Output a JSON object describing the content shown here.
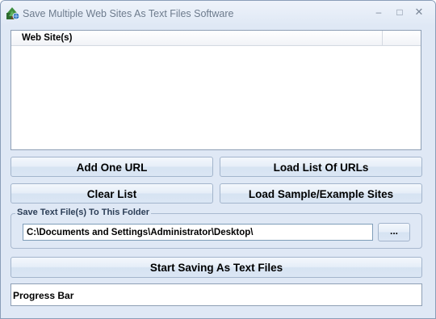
{
  "window": {
    "title": "Save Multiple Web Sites As Text Files Software",
    "minimize_glyph": "–",
    "maximize_glyph": "□",
    "close_glyph": "✕"
  },
  "list": {
    "column_header": "Web Site(s)",
    "items": []
  },
  "buttons": {
    "add_one_url": "Add One URL",
    "load_list": "Load List Of URLs",
    "clear_list": "Clear List",
    "load_sample": "Load Sample/Example Sites",
    "start": "Start Saving As Text Files"
  },
  "output_folder": {
    "group_label": "Save Text File(s) To This Folder",
    "path": "C:\\Documents and Settings\\Administrator\\Desktop\\",
    "browse_label": "..."
  },
  "progress": {
    "label": "Progress Bar",
    "value": 0
  },
  "icons": {
    "app": "tree-globe-icon"
  }
}
